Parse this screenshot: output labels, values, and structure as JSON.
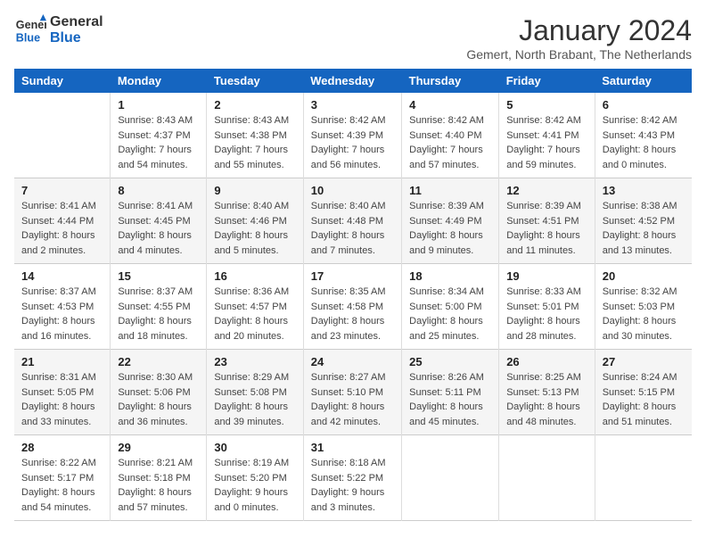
{
  "header": {
    "logo_line1": "General",
    "logo_line2": "Blue",
    "title": "January 2024",
    "subtitle": "Gemert, North Brabant, The Netherlands"
  },
  "days_of_week": [
    "Sunday",
    "Monday",
    "Tuesday",
    "Wednesday",
    "Thursday",
    "Friday",
    "Saturday"
  ],
  "weeks": [
    [
      {
        "day": "",
        "info": ""
      },
      {
        "day": "1",
        "info": "Sunrise: 8:43 AM\nSunset: 4:37 PM\nDaylight: 7 hours\nand 54 minutes."
      },
      {
        "day": "2",
        "info": "Sunrise: 8:43 AM\nSunset: 4:38 PM\nDaylight: 7 hours\nand 55 minutes."
      },
      {
        "day": "3",
        "info": "Sunrise: 8:42 AM\nSunset: 4:39 PM\nDaylight: 7 hours\nand 56 minutes."
      },
      {
        "day": "4",
        "info": "Sunrise: 8:42 AM\nSunset: 4:40 PM\nDaylight: 7 hours\nand 57 minutes."
      },
      {
        "day": "5",
        "info": "Sunrise: 8:42 AM\nSunset: 4:41 PM\nDaylight: 7 hours\nand 59 minutes."
      },
      {
        "day": "6",
        "info": "Sunrise: 8:42 AM\nSunset: 4:43 PM\nDaylight: 8 hours\nand 0 minutes."
      }
    ],
    [
      {
        "day": "7",
        "info": "Sunrise: 8:41 AM\nSunset: 4:44 PM\nDaylight: 8 hours\nand 2 minutes."
      },
      {
        "day": "8",
        "info": "Sunrise: 8:41 AM\nSunset: 4:45 PM\nDaylight: 8 hours\nand 4 minutes."
      },
      {
        "day": "9",
        "info": "Sunrise: 8:40 AM\nSunset: 4:46 PM\nDaylight: 8 hours\nand 5 minutes."
      },
      {
        "day": "10",
        "info": "Sunrise: 8:40 AM\nSunset: 4:48 PM\nDaylight: 8 hours\nand 7 minutes."
      },
      {
        "day": "11",
        "info": "Sunrise: 8:39 AM\nSunset: 4:49 PM\nDaylight: 8 hours\nand 9 minutes."
      },
      {
        "day": "12",
        "info": "Sunrise: 8:39 AM\nSunset: 4:51 PM\nDaylight: 8 hours\nand 11 minutes."
      },
      {
        "day": "13",
        "info": "Sunrise: 8:38 AM\nSunset: 4:52 PM\nDaylight: 8 hours\nand 13 minutes."
      }
    ],
    [
      {
        "day": "14",
        "info": "Sunrise: 8:37 AM\nSunset: 4:53 PM\nDaylight: 8 hours\nand 16 minutes."
      },
      {
        "day": "15",
        "info": "Sunrise: 8:37 AM\nSunset: 4:55 PM\nDaylight: 8 hours\nand 18 minutes."
      },
      {
        "day": "16",
        "info": "Sunrise: 8:36 AM\nSunset: 4:57 PM\nDaylight: 8 hours\nand 20 minutes."
      },
      {
        "day": "17",
        "info": "Sunrise: 8:35 AM\nSunset: 4:58 PM\nDaylight: 8 hours\nand 23 minutes."
      },
      {
        "day": "18",
        "info": "Sunrise: 8:34 AM\nSunset: 5:00 PM\nDaylight: 8 hours\nand 25 minutes."
      },
      {
        "day": "19",
        "info": "Sunrise: 8:33 AM\nSunset: 5:01 PM\nDaylight: 8 hours\nand 28 minutes."
      },
      {
        "day": "20",
        "info": "Sunrise: 8:32 AM\nSunset: 5:03 PM\nDaylight: 8 hours\nand 30 minutes."
      }
    ],
    [
      {
        "day": "21",
        "info": "Sunrise: 8:31 AM\nSunset: 5:05 PM\nDaylight: 8 hours\nand 33 minutes."
      },
      {
        "day": "22",
        "info": "Sunrise: 8:30 AM\nSunset: 5:06 PM\nDaylight: 8 hours\nand 36 minutes."
      },
      {
        "day": "23",
        "info": "Sunrise: 8:29 AM\nSunset: 5:08 PM\nDaylight: 8 hours\nand 39 minutes."
      },
      {
        "day": "24",
        "info": "Sunrise: 8:27 AM\nSunset: 5:10 PM\nDaylight: 8 hours\nand 42 minutes."
      },
      {
        "day": "25",
        "info": "Sunrise: 8:26 AM\nSunset: 5:11 PM\nDaylight: 8 hours\nand 45 minutes."
      },
      {
        "day": "26",
        "info": "Sunrise: 8:25 AM\nSunset: 5:13 PM\nDaylight: 8 hours\nand 48 minutes."
      },
      {
        "day": "27",
        "info": "Sunrise: 8:24 AM\nSunset: 5:15 PM\nDaylight: 8 hours\nand 51 minutes."
      }
    ],
    [
      {
        "day": "28",
        "info": "Sunrise: 8:22 AM\nSunset: 5:17 PM\nDaylight: 8 hours\nand 54 minutes."
      },
      {
        "day": "29",
        "info": "Sunrise: 8:21 AM\nSunset: 5:18 PM\nDaylight: 8 hours\nand 57 minutes."
      },
      {
        "day": "30",
        "info": "Sunrise: 8:19 AM\nSunset: 5:20 PM\nDaylight: 9 hours\nand 0 minutes."
      },
      {
        "day": "31",
        "info": "Sunrise: 8:18 AM\nSunset: 5:22 PM\nDaylight: 9 hours\nand 3 minutes."
      },
      {
        "day": "",
        "info": ""
      },
      {
        "day": "",
        "info": ""
      },
      {
        "day": "",
        "info": ""
      }
    ]
  ]
}
